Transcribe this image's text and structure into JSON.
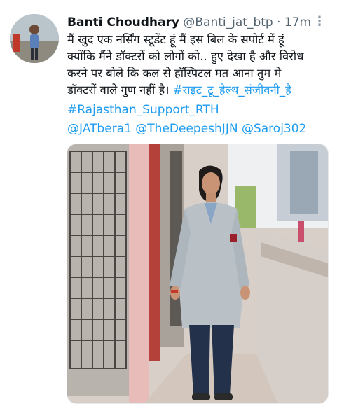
{
  "tweet": {
    "author_name": "Banti Choudhary",
    "handle": "@Banti_jat_btp",
    "separator": "·",
    "time": "17m",
    "more_icon": "more-vertical-icon",
    "text_lines": [
      "मैं खुद एक नर्सिंग स्टूडेंट हूं मैं इस बिल के सपोर्ट में हूं",
      "क्योंकि मैंने डॉक्टरों को लोगों को.. हुए देखा है और विरोध",
      "करने पर बोले कि कल से हॉस्पिटल मत आना तुम मे",
      "डॉक्टरों वाले गुण नहीं है।"
    ],
    "hashtag_inline": "#राइट_टू_हेल्थ_संजीवनी_है",
    "hashtag_2": "#Rajasthan_Support_RTH",
    "mentions": [
      "@JATbera1",
      "@TheDeepeshJJN",
      "@Saroj302"
    ],
    "link_color": "#1d9bf0",
    "name_color": "#0f1419",
    "meta_color": "#536471"
  }
}
